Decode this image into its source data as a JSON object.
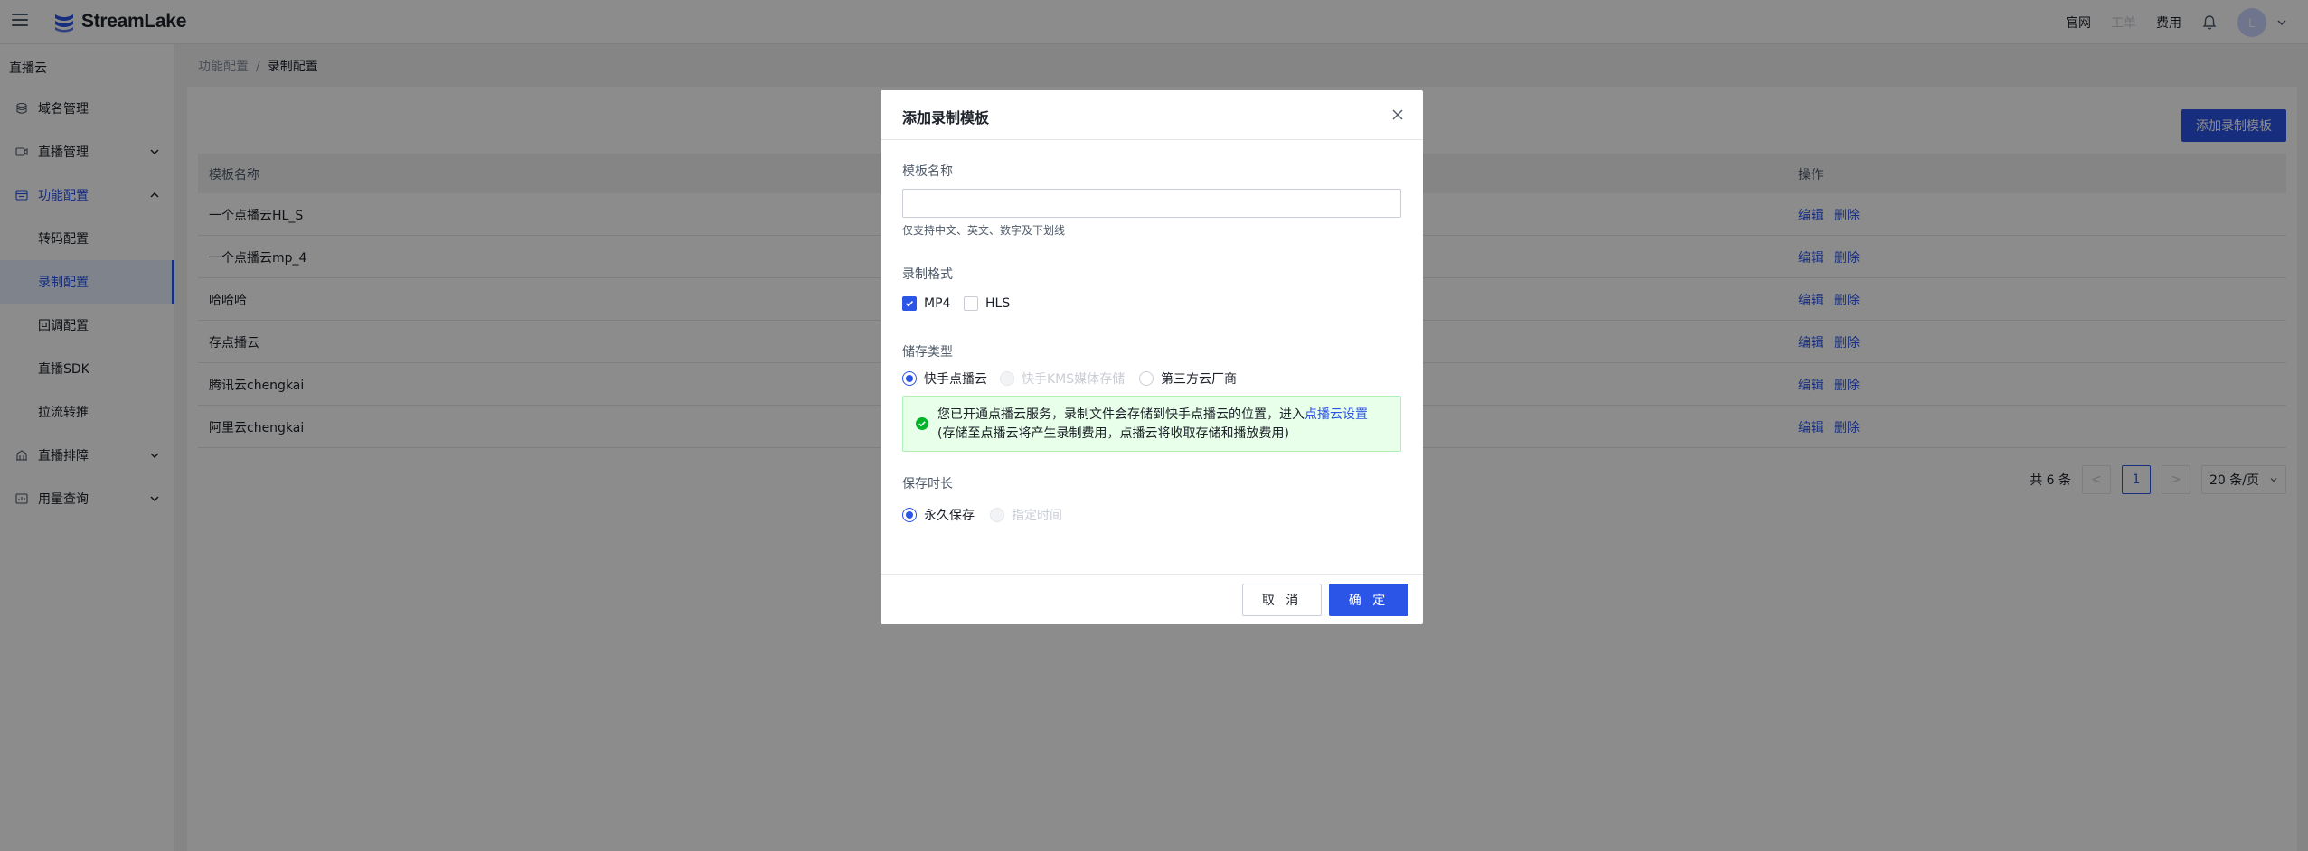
{
  "header": {
    "logo_text": "StreamLake",
    "links": {
      "official": "官网",
      "ticket": "工单",
      "billing": "费用"
    },
    "avatar_letter": "L"
  },
  "sidebar": {
    "title": "直播云",
    "items": [
      {
        "label": "域名管理"
      },
      {
        "label": "直播管理"
      },
      {
        "label": "功能配置"
      },
      {
        "label": "转码配置"
      },
      {
        "label": "录制配置"
      },
      {
        "label": "回调配置"
      },
      {
        "label": "直播SDK"
      },
      {
        "label": "拉流转推"
      },
      {
        "label": "直播排障"
      },
      {
        "label": "用量查询"
      }
    ]
  },
  "breadcrumb": {
    "parent": "功能配置",
    "separator": "/",
    "current": "录制配置"
  },
  "main": {
    "add_button": "添加录制模板",
    "columns": {
      "name": "模板名称",
      "actions": "操作"
    },
    "rows": [
      {
        "name": "一个点播云HL_S",
        "edit": "编辑",
        "delete": "删除"
      },
      {
        "name": "一个点播云mp_4",
        "edit": "编辑",
        "delete": "删除"
      },
      {
        "name": "哈哈哈",
        "edit": "编辑",
        "delete": "删除"
      },
      {
        "name": "存点播云",
        "edit": "编辑",
        "delete": "删除"
      },
      {
        "name": "腾讯云chengkai",
        "edit": "编辑",
        "delete": "删除"
      },
      {
        "name": "阿里云chengkai",
        "edit": "编辑",
        "delete": "删除"
      }
    ],
    "pagination": {
      "total": "共 6 条",
      "prev": "<",
      "page": "1",
      "next": ">",
      "page_size": "20 条/页"
    }
  },
  "modal": {
    "title": "添加录制模板",
    "name_label": "模板名称",
    "name_value": "",
    "name_hint": "仅支持中文、英文、数字及下划线",
    "format_label": "录制格式",
    "format_options": [
      {
        "label": "MP4",
        "checked": true
      },
      {
        "label": "HLS",
        "checked": false
      }
    ],
    "storage_label": "储存类型",
    "storage_options": [
      {
        "label": "快手点播云",
        "selected": true,
        "disabled": false
      },
      {
        "label": "快手KMS媒体存储",
        "selected": false,
        "disabled": true
      },
      {
        "label": "第三方云厂商",
        "selected": false,
        "disabled": false
      }
    ],
    "notice_text_1": "您已开通点播云服务，录制文件会存储到快手点播云的位置，进入",
    "notice_link": "点播云设置",
    "notice_text_2": "(存储至点播云将产生录制费用，点播云将收取存储和播放费用)",
    "duration_label": "保存时长",
    "duration_options": [
      {
        "label": "永久保存",
        "selected": true,
        "disabled": false
      },
      {
        "label": "指定时间",
        "selected": false,
        "disabled": true
      }
    ],
    "cancel": "取 消",
    "confirm": "确 定"
  },
  "colors": {
    "primary": "#2b55e6",
    "success": "#00b42a",
    "mask": "rgba(0,0,0,0.45)"
  }
}
